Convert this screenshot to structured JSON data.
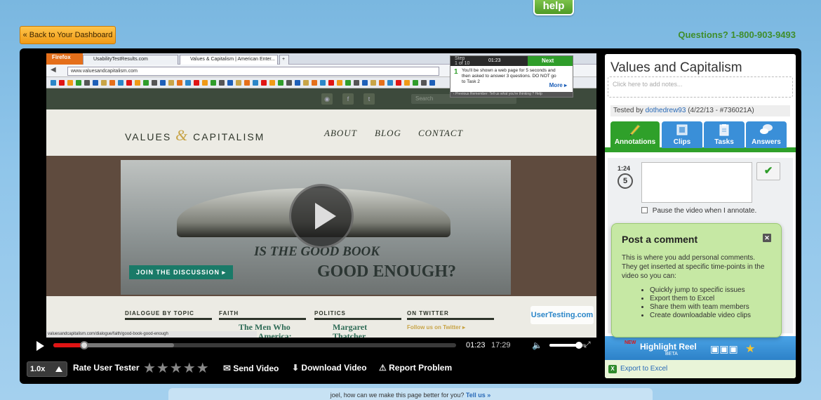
{
  "header": {
    "help_label": "help",
    "dashboard_button": "« Back to Your Dashboard",
    "phone": "Questions? 1-800-903-9493"
  },
  "browser": {
    "firefox_button": "Firefox",
    "tabs": [
      {
        "label": "UsabilityTestResults.com"
      },
      {
        "label": "Values & Capitalism | American Enter..."
      }
    ],
    "new_tab": "+",
    "url": "www.valuesandcapitalism.com",
    "status_url": "valuesandcapitalism.com/dialogue/faith/good-book-good-enough"
  },
  "site": {
    "search_placeholder": "Search",
    "logo_left": "VALUES",
    "logo_amp": "&",
    "logo_right": "CAPITALISM",
    "nav": [
      "ABOUT",
      "BLOG",
      "CONTACT"
    ],
    "hero_line1": "IS THE GOOD BOOK",
    "hero_line2": "GOOD ENOUGH?",
    "join_label": "JOIN THE DISCUSSION ▸",
    "columns": [
      {
        "heading": "DIALOGUE BY TOPIC",
        "text": ""
      },
      {
        "heading": "FAITH",
        "text": "The Men Who Built America:"
      },
      {
        "heading": "POLITICS",
        "text": "Margaret Thatcher,"
      },
      {
        "heading": "ON TWITTER",
        "text": "Follow us on Twitter ▸"
      }
    ],
    "usertesting_logo": "UserTesting.com"
  },
  "task": {
    "step_label": "Step",
    "step_count": "1 of 10",
    "timer": "01:23",
    "next_label": "Next",
    "number": "1",
    "text": "You'll be shown a web page for 5 seconds and then asked to answer 3 questions. DO NOT go to Task 2",
    "more_label": "More ▸",
    "footer": "‹ Previous   Remember: Tell us what you're thinking   ? Help"
  },
  "controls": {
    "current_time": "01:23",
    "total_time": "17:29",
    "progress": 0.079,
    "buffered": 0.3,
    "volume": 0.8,
    "speed_label": "1.0x",
    "rate_label": "Rate User Tester",
    "stars": "★★★★★",
    "send_video": "Send Video",
    "download_video": "Download Video",
    "report_problem": "Report Problem"
  },
  "panel": {
    "title": "Values and Capitalism",
    "notes_placeholder": "Click here to add notes...",
    "tested_by_label": "Tested by",
    "tester": "dothedrew93",
    "test_meta": "(4/22/13 - #736021A)",
    "tabs": [
      {
        "label": "Annotations",
        "color": "#2fa02a"
      },
      {
        "label": "Clips",
        "color": "#3a8fd8"
      },
      {
        "label": "Tasks",
        "color": "#3a8fd8"
      },
      {
        "label": "Answers",
        "color": "#3a8fd8"
      }
    ],
    "annotation_time": "1:24",
    "replay_seconds": "5",
    "checkmark": "✔",
    "pause_label": "Pause the video when I annotate.",
    "highlight_reel": "Highlight Reel",
    "highlight_badge": "NEW",
    "beta_label": "BETA",
    "export_label": "Export to Excel"
  },
  "popup": {
    "title": "Post a comment",
    "close": "✕",
    "description": "This is where you add personal comments. They get inserted at specific time-points in the video so you can:",
    "items": [
      "Quickly jump to specific issues",
      "Export them to Excel",
      "Share them with team members",
      "Create downloadable video clips"
    ]
  },
  "feedback": {
    "text": "joel, how can we make this page better for you?",
    "link": "Tell us »"
  }
}
